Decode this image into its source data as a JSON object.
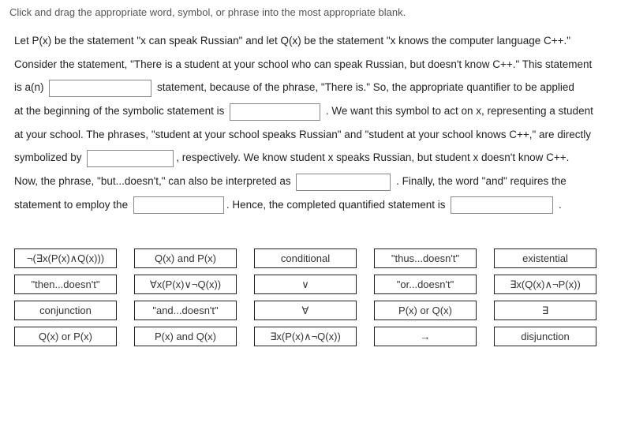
{
  "instruction": "Click and drag the appropriate word, symbol, or phrase into the most appropriate blank.",
  "para": {
    "t1": "Let P(x) be the statement \"x can speak Russian\" and let Q(x) be the statement \"x knows the computer language C++.\"",
    "t2": "Consider the statement, \"There is a student at your school who can speak Russian, but doesn't know C++.\" This statement",
    "t3": "is a(n) ",
    "t4": " statement, because of the phrase, \"There is.\" So, the appropriate quantifier to be applied",
    "t5": "at the beginning of the symbolic statement is ",
    "t6": " . We want this symbol to act on x, representing a student",
    "t7": "at your school. The phrases, \"student at your school speaks Russian\" and \"student at your school knows C++,\" are directly",
    "t8": "symbolized by ",
    "t9": ", respectively. We know student x speaks Russian, but student x doesn't know C++.",
    "t10": "Now, the phrase, \"but...doesn't,\" can also be interpreted as ",
    "t11": " . Finally, the word \"and\" requires the",
    "t12": "statement to employ the ",
    "t13": ". Hence, the completed quantified statement is ",
    "t14": " ."
  },
  "tiles": {
    "c1": [
      "¬(∃x(P(x)∧Q(x)))",
      "\"then...doesn't\"",
      "conjunction",
      "Q(x) or P(x)"
    ],
    "c2": [
      "Q(x) and P(x)",
      "∀x(P(x)∨¬Q(x))",
      "\"and...doesn't\"",
      "P(x) and Q(x)"
    ],
    "c3": [
      "conditional",
      "∨",
      "∀",
      "∃x(P(x)∧¬Q(x))"
    ],
    "c4": [
      "\"thus...doesn't\"",
      "\"or...doesn't\"",
      "P(x) or Q(x)",
      "→"
    ],
    "c5": [
      "existential",
      "∃x(Q(x)∧¬P(x))",
      "∃",
      "disjunction"
    ]
  }
}
